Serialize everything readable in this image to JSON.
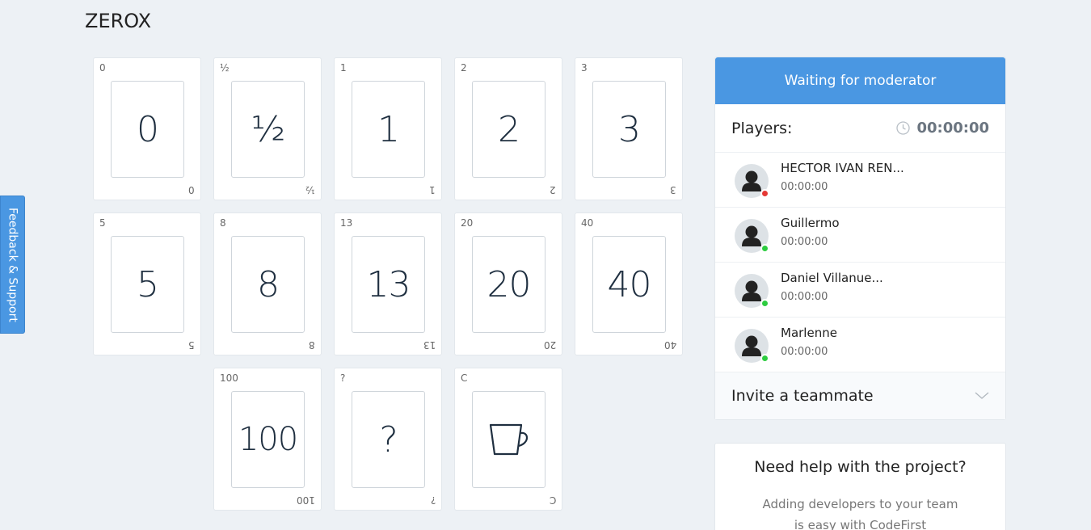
{
  "page": {
    "title": "ZEROX"
  },
  "cards": [
    {
      "value": "0"
    },
    {
      "value": "½"
    },
    {
      "value": "1"
    },
    {
      "value": "2"
    },
    {
      "value": "3"
    },
    {
      "value": "5"
    },
    {
      "value": "8"
    },
    {
      "value": "13"
    },
    {
      "value": "20"
    },
    {
      "value": "40"
    },
    {
      "value": "100"
    },
    {
      "value": "?"
    },
    {
      "value": "C",
      "icon": "coffee-cup-icon"
    }
  ],
  "sidebar": {
    "status": "Waiting for moderator",
    "players_label": "Players:",
    "timer": "00:00:00",
    "players": [
      {
        "name": "HECTOR IVAN REN...",
        "time": "00:00:00",
        "status_color": "#e53935"
      },
      {
        "name": "Guillermo",
        "time": "00:00:00",
        "status_color": "#2ecc40"
      },
      {
        "name": "Daniel Villanue...",
        "time": "00:00:00",
        "status_color": "#2ecc40"
      },
      {
        "name": "Marlenne",
        "time": "00:00:00",
        "status_color": "#2ecc40"
      }
    ],
    "invite_label": "Invite a teammate"
  },
  "help": {
    "title": "Need help with the project?",
    "line1": "Adding developers to your team",
    "line2": "is easy with CodeFirst"
  },
  "feedback_label": "Feedback & Support",
  "colors": {
    "accent": "#4a97e2",
    "background": "#edf1f5"
  }
}
